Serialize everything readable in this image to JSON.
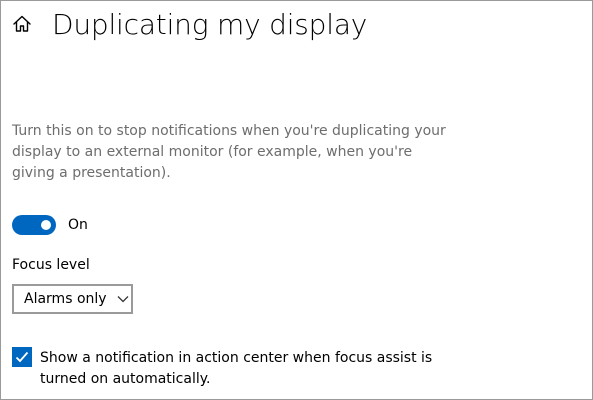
{
  "header": {
    "home_icon": "home-icon",
    "title": "Duplicating my display"
  },
  "description": "Turn this on to stop notifications when you're duplicating your display to an external monitor (for example, when you're giving a presentation).",
  "toggle": {
    "state": "on",
    "label": "On",
    "accent_color": "#0067c0"
  },
  "focus_level": {
    "label": "Focus level",
    "selected": "Alarms only",
    "icon": "chevron-down-icon"
  },
  "notification_checkbox": {
    "checked": true,
    "label": "Show a notification in action center when focus assist is turned on automatically."
  }
}
